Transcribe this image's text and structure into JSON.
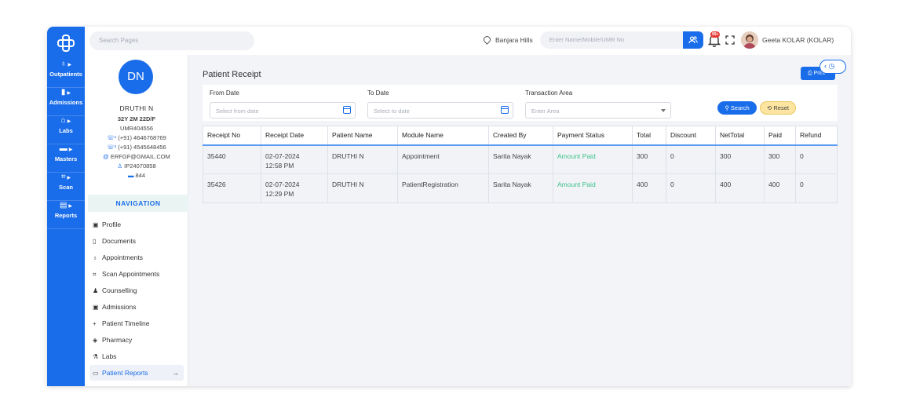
{
  "rail": {
    "items": [
      {
        "label": "Outpatients",
        "icon": "stethoscope-icon"
      },
      {
        "label": "Admissions",
        "icon": "file-icon"
      },
      {
        "label": "Labs",
        "icon": "home-icon"
      },
      {
        "label": "Masters",
        "icon": "monitor-icon"
      },
      {
        "label": "Scan",
        "icon": "scan-icon"
      },
      {
        "label": "Reports",
        "icon": "report-icon"
      }
    ]
  },
  "topbar": {
    "search_placeholder": "Search Pages",
    "location": "Banjara Hills",
    "umr_placeholder": "Enter Name/Mobile/UMR No",
    "notification_badge": "99+",
    "user_name": "Geeta KOLAR (KOLAR)"
  },
  "patient": {
    "initials": "DN",
    "name": "DRUTHI N",
    "age_gender": "32Y 2M 22D/F",
    "umr": "UMR404556",
    "phone1": "(+91) 4646768769",
    "phone2": "(+91) 4545648456",
    "email": "ERFGF@GMAIL.COM",
    "ip": "IP24070858",
    "room": "844"
  },
  "navigation": {
    "heading": "NAVIGATION",
    "items": [
      {
        "label": "Profile"
      },
      {
        "label": "Documents"
      },
      {
        "label": "Appointments"
      },
      {
        "label": "Scan Appointments"
      },
      {
        "label": "Counselling"
      },
      {
        "label": "Admissions"
      },
      {
        "label": "Patient Timeline"
      },
      {
        "label": "Pharmacy"
      },
      {
        "label": "Labs"
      },
      {
        "label": "Patient Reports"
      }
    ]
  },
  "main": {
    "title": "Patient Receipt",
    "print_label": "Print",
    "filters": {
      "from_label": "From Date",
      "from_placeholder": "Select from date",
      "to_label": "To Date",
      "to_placeholder": "Select to date",
      "area_label": "Transaction Area",
      "area_placeholder": "Enter Area",
      "search_label": "Search",
      "reset_label": "Reset"
    },
    "table": {
      "headers": [
        "Receipt No",
        "Receipt Date",
        "Patient Name",
        "Module Name",
        "Created By",
        "Payment Status",
        "Total",
        "Discount",
        "NetTotal",
        "Paid",
        "Refund"
      ],
      "rows": [
        [
          "35440",
          "02-07-2024",
          "12:58 PM",
          "DRUTHI N",
          "Appointment",
          "Sarita Nayak",
          "Amount Paid",
          "300",
          "0",
          "300",
          "300",
          "0"
        ],
        [
          "35426",
          "02-07-2024",
          "12:29 PM",
          "DRUTHI N",
          "PatientRegistration",
          "Sarita Nayak",
          "Amount Paid",
          "400",
          "0",
          "400",
          "400",
          "0"
        ]
      ]
    }
  }
}
